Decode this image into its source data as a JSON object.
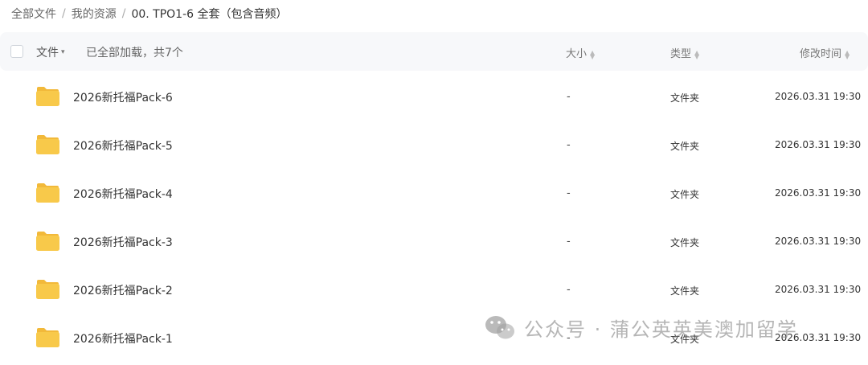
{
  "breadcrumb": {
    "items": [
      "全部文件",
      "我的资源",
      "00. TPO1-6 全套（包含音频）"
    ],
    "separator": "/"
  },
  "header": {
    "name_label": "文件",
    "name_caret": "▾",
    "load_status": "已全部加载，共7个",
    "size_label": "大小",
    "type_label": "类型",
    "time_label": "修改时间"
  },
  "rows": [
    {
      "name": "2026新托福Pack-6",
      "size": "-",
      "type": "文件夹",
      "time": "2026.03.31 19:30",
      "icon": "folder-icon"
    },
    {
      "name": "2026新托福Pack-5",
      "size": "-",
      "type": "文件夹",
      "time": "2026.03.31 19:30",
      "icon": "folder-icon"
    },
    {
      "name": "2026新托福Pack-4",
      "size": "-",
      "type": "文件夹",
      "time": "2026.03.31 19:30",
      "icon": "folder-icon"
    },
    {
      "name": "2026新托福Pack-3",
      "size": "-",
      "type": "文件夹",
      "time": "2026.03.31 19:30",
      "icon": "folder-icon"
    },
    {
      "name": "2026新托福Pack-2",
      "size": "-",
      "type": "文件夹",
      "time": "2026.03.31 19:30",
      "icon": "folder-icon"
    },
    {
      "name": "2026新托福Pack-1",
      "size": "-",
      "type": "文件夹",
      "time": "2026.03.31 19:30",
      "icon": "folder-icon"
    }
  ],
  "watermark": {
    "text": "公众号 · 蒲公英英美澳加留学",
    "icon": "wechat-icon"
  },
  "colors": {
    "folder": "#f8c94a",
    "folder_dark": "#f2b93a",
    "header_bg": "#f7f8fa"
  }
}
